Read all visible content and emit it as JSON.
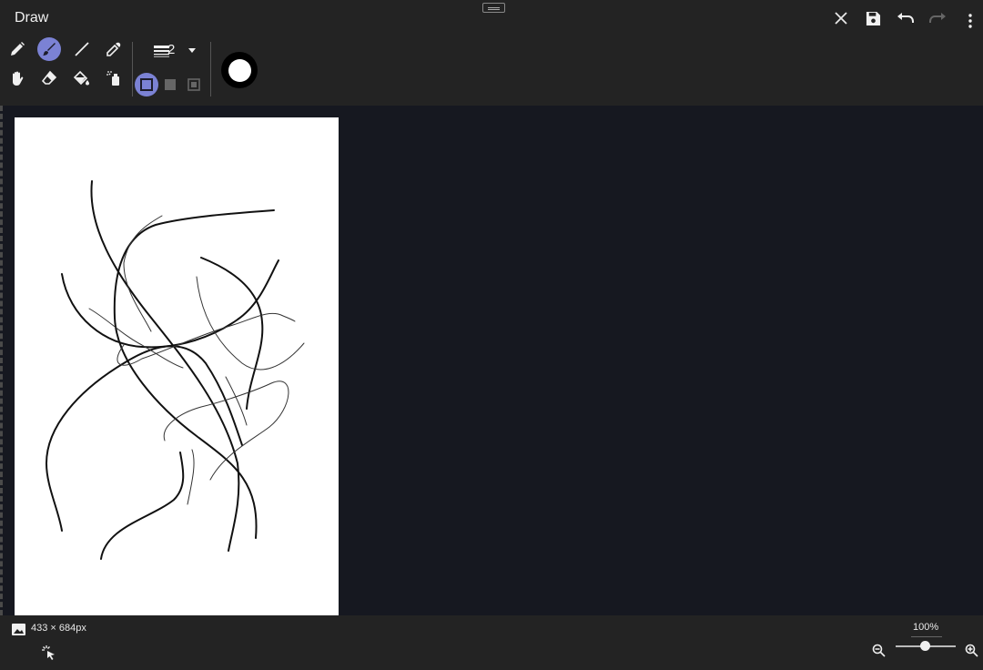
{
  "app": {
    "title": "Draw"
  },
  "toolbar": {
    "stroke_width": "2",
    "tools": [
      "pencil",
      "brush",
      "line",
      "eyedropper",
      "pan",
      "eraser",
      "fill",
      "spray"
    ],
    "active_tool": "brush",
    "active_shape_style": "outline",
    "colors": {
      "accent": "#7b82d4",
      "current_color": "#ffffff",
      "current_outline": "#000000"
    }
  },
  "status": {
    "dimensions": "433 × 684px",
    "zoom": "100%",
    "zoom_level": 0.5
  }
}
